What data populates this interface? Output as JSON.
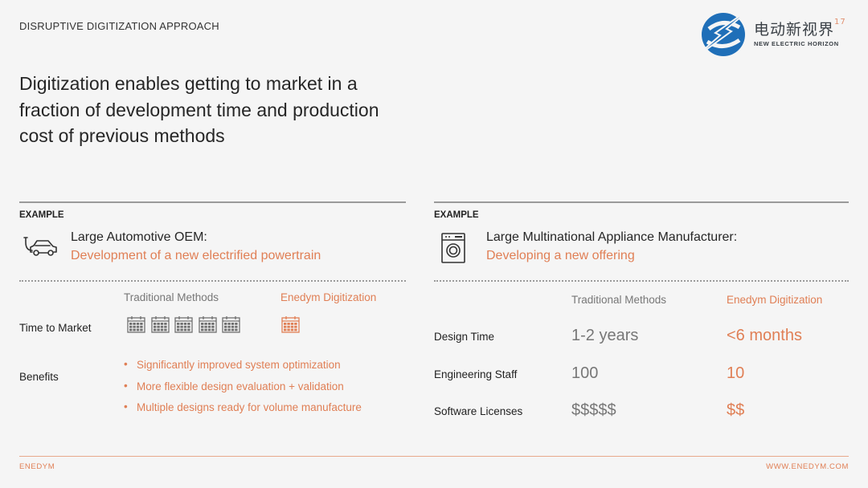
{
  "header": {
    "kicker": "DISRUPTIVE DIGITIZATION APPROACH",
    "headline": "Digitization enables getting to market in a fraction of development time and production cost of previous methods"
  },
  "logo": {
    "cn": "电动新视界",
    "sup": "17",
    "en": "NEW ELECTRIC HORIZON"
  },
  "left": {
    "example_label": "EXAMPLE",
    "icon": "electric-car-icon",
    "title": "Large Automotive OEM:",
    "subtitle": "Development of a new electrified powertrain",
    "col_traditional": "Traditional Methods",
    "col_enedym": "Enedym Digitization",
    "row_time": "Time to Market",
    "traditional_calendars": 5,
    "enedym_calendars": 1,
    "row_benefits": "Benefits",
    "benefits": [
      "Significantly improved system optimization",
      "More flexible design evaluation + validation",
      "Multiple designs ready for volume manufacture"
    ]
  },
  "right": {
    "example_label": "EXAMPLE",
    "icon": "washing-machine-icon",
    "title": "Large Multinational Appliance Manufacturer:",
    "subtitle": "Developing a new offering",
    "col_traditional": "Traditional Methods",
    "col_enedym": "Enedym Digitization",
    "rows": [
      {
        "label": "Design Time",
        "traditional": "1-2 years",
        "enedym": "<6 months"
      },
      {
        "label": "Engineering Staff",
        "traditional": "100",
        "enedym": "10"
      },
      {
        "label": "Software Licenses",
        "traditional": "$$$$$",
        "enedym": "$$"
      }
    ]
  },
  "footer": {
    "left": "ENEDYM",
    "right": "WWW.ENEDYM.COM"
  },
  "colors": {
    "accent": "#e07f55",
    "rule": "#9a9a9a",
    "logo_blue": "#1f6fb8"
  }
}
